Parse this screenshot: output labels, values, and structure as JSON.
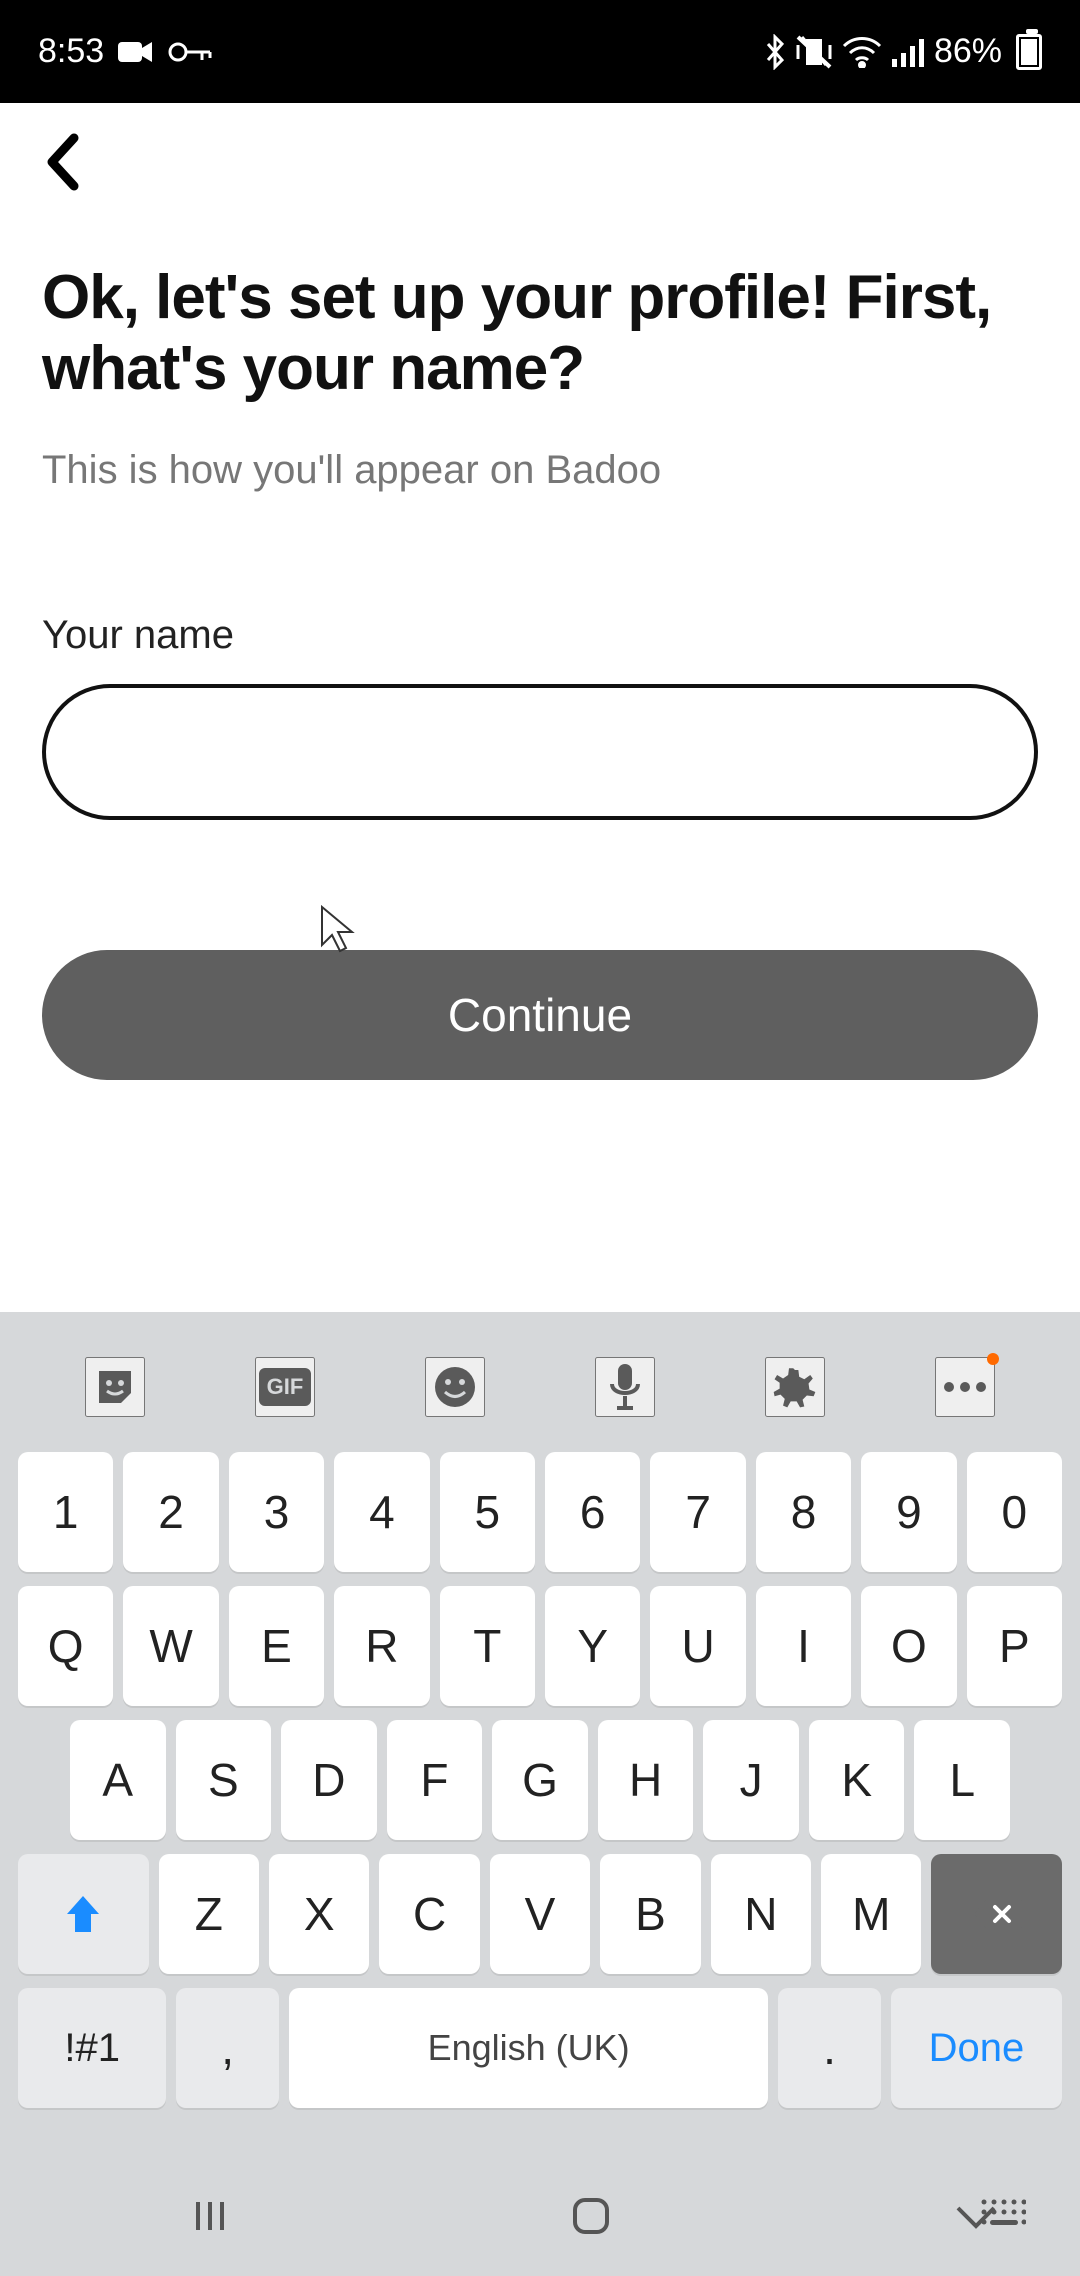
{
  "status": {
    "time": "8:53",
    "battery_pct": "86%"
  },
  "page": {
    "heading": "Ok, let's set up your profile! First, what's your name?",
    "subtext": "This is how you'll appear on Badoo",
    "input_label": "Your name",
    "input_value": "",
    "continue_label": "Continue"
  },
  "keyboard": {
    "row_numbers": [
      "1",
      "2",
      "3",
      "4",
      "5",
      "6",
      "7",
      "8",
      "9",
      "0"
    ],
    "row_top": [
      "Q",
      "W",
      "E",
      "R",
      "T",
      "Y",
      "U",
      "I",
      "O",
      "P"
    ],
    "row_home": [
      "A",
      "S",
      "D",
      "F",
      "G",
      "H",
      "J",
      "K",
      "L"
    ],
    "row_bottom": [
      "Z",
      "X",
      "C",
      "V",
      "B",
      "N",
      "M"
    ],
    "symbols_label": "!#1",
    "comma_label": ",",
    "space_label": "English (UK)",
    "period_label": ".",
    "done_label": "Done"
  }
}
